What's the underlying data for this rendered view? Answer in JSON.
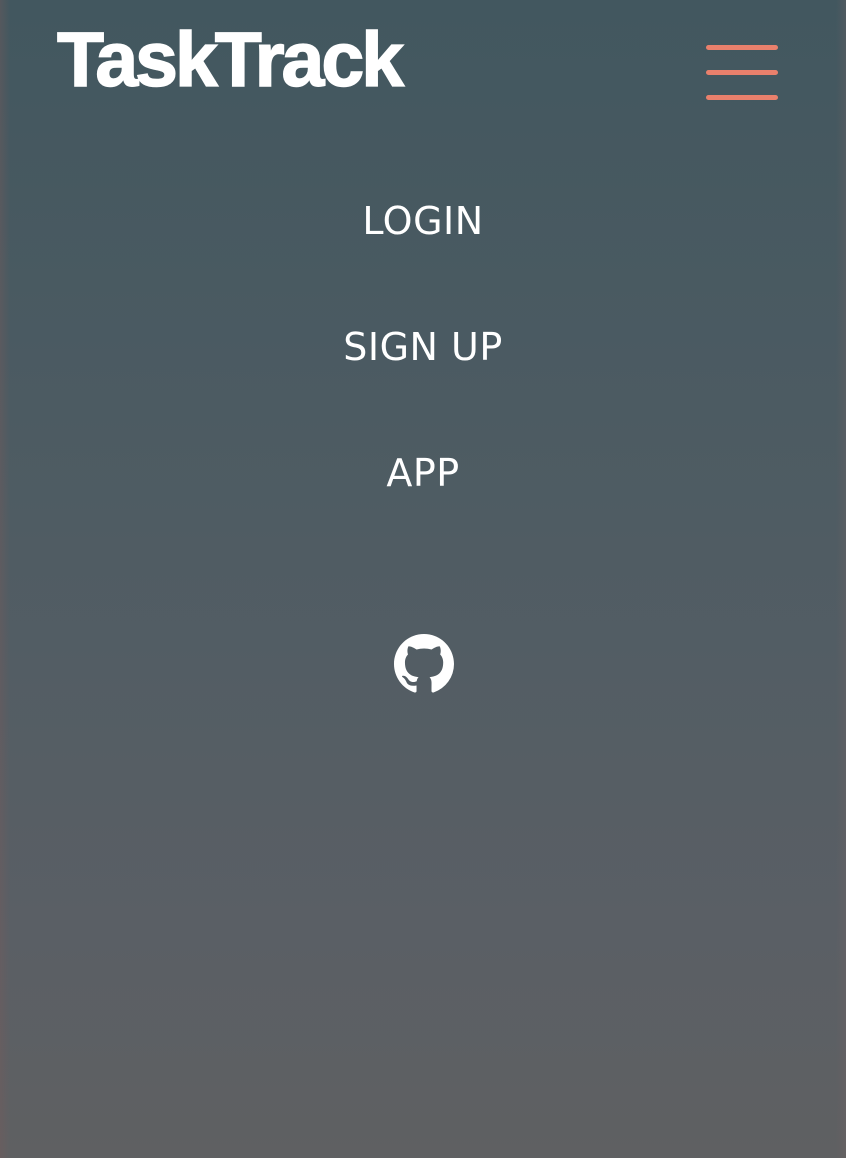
{
  "header": {
    "brand": "TaskTrack",
    "menu_icon": "hamburger-menu-icon",
    "menu_icon_color": "#e9806c"
  },
  "nav": {
    "items": [
      {
        "label": "LOGIN"
      },
      {
        "label": "SIGN UP"
      },
      {
        "label": "APP"
      }
    ]
  },
  "footer": {
    "github_icon": "github-icon"
  },
  "colors": {
    "background_top": "#42575f",
    "background_bottom": "#5f6062",
    "text": "#ffffff",
    "accent": "#e9806c"
  }
}
